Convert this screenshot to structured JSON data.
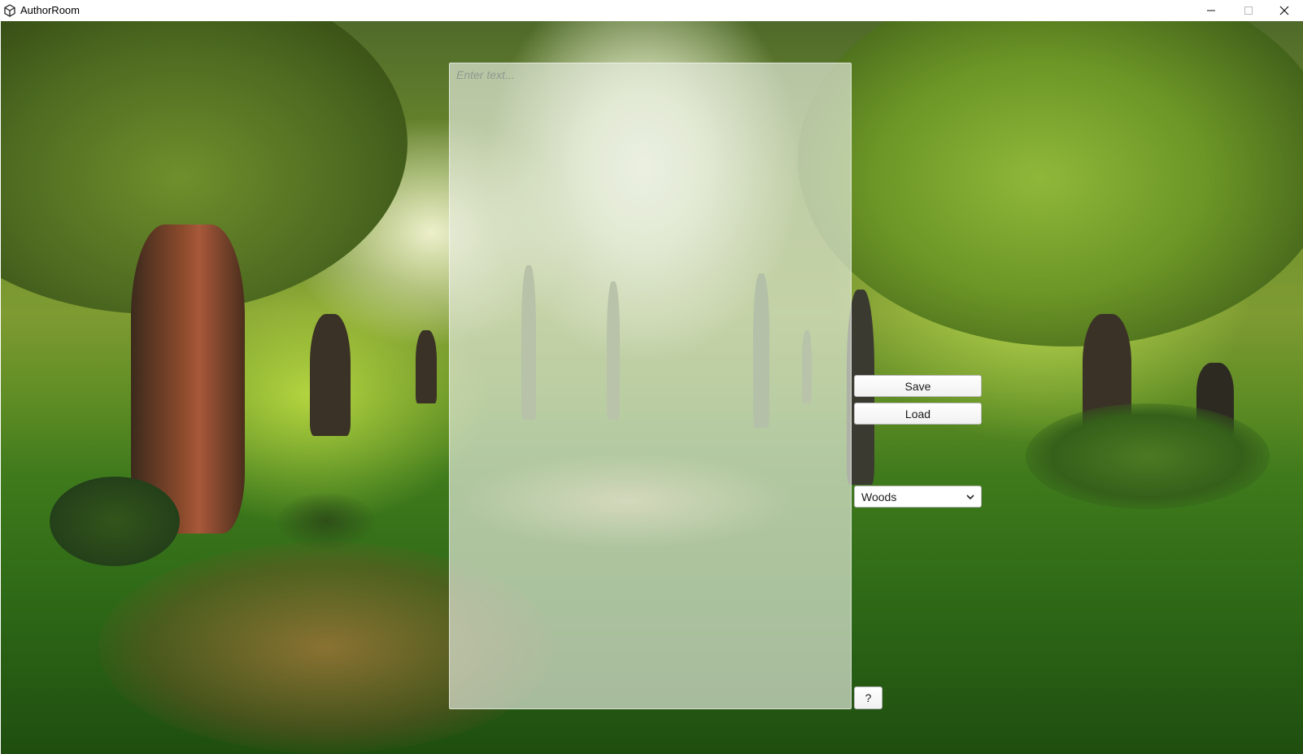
{
  "window": {
    "title": "AuthorRoom",
    "app_icon": "unity-icon",
    "controls": [
      "minimize-icon",
      "maximize-icon",
      "close-icon"
    ]
  },
  "scene": {
    "background": "forest-background-image"
  },
  "editor": {
    "placeholder": "Enter text...",
    "value": ""
  },
  "actions": {
    "save_label": "Save",
    "load_label": "Load",
    "help_label": "?"
  },
  "environment_select": {
    "selected": "Woods",
    "icon": "chevron-down-icon"
  }
}
